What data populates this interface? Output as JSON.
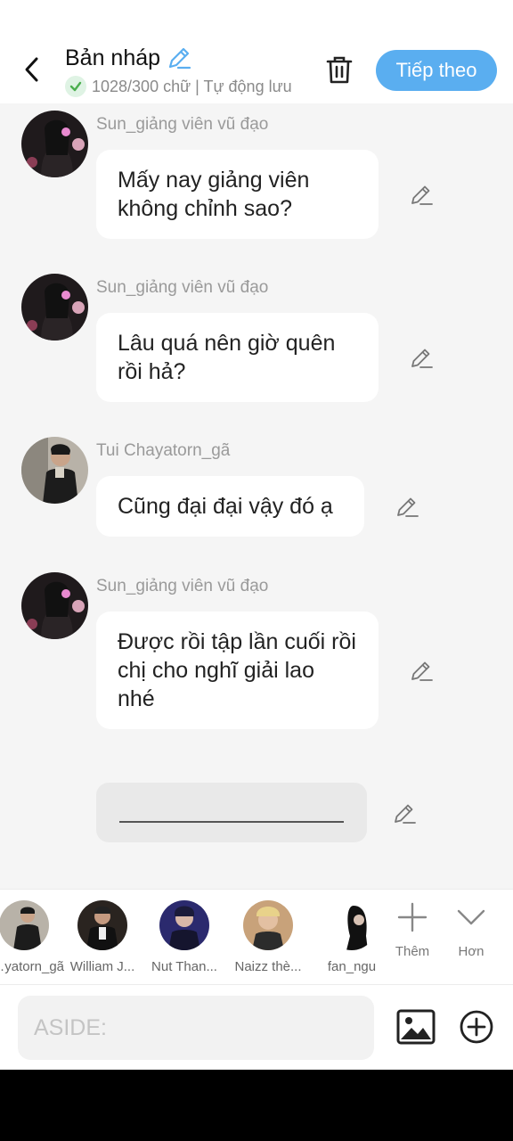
{
  "header": {
    "title": "Bản nháp",
    "word_count": "1028/300 chữ | Tự động lưu",
    "next_label": "Tiếp theo"
  },
  "messages": [
    {
      "sender": "Sun_giảng viên vũ đạo",
      "text": "Mấy nay giảng viên không chỉnh sao?"
    },
    {
      "sender": "Sun_giảng viên vũ đạo",
      "text": "Lâu quá nên giờ quên rồi hả?"
    },
    {
      "sender": "Tui Chayatorn_gã",
      "text": "Cũng đại đại vậy đó ạ"
    },
    {
      "sender": "Sun_giảng viên vũ đạo",
      "text": "Được rồi tập lần cuối rồi chị cho nghĩ giải lao nhé"
    }
  ],
  "characters": [
    {
      "name": "Tui Chayatorn_gã"
    },
    {
      "name": "William J..."
    },
    {
      "name": "Nut Than..."
    },
    {
      "name": "Naizz thè..."
    },
    {
      "name": "fan_ngu"
    }
  ],
  "tools": {
    "more_label": "Thêm",
    "expand_label": "Hơn"
  },
  "input": {
    "placeholder": "ASIDE:"
  },
  "colors": {
    "accent": "#5aaef0",
    "background": "#f5f5f5",
    "bubble": "#ffffff",
    "check": "#4caf50"
  }
}
